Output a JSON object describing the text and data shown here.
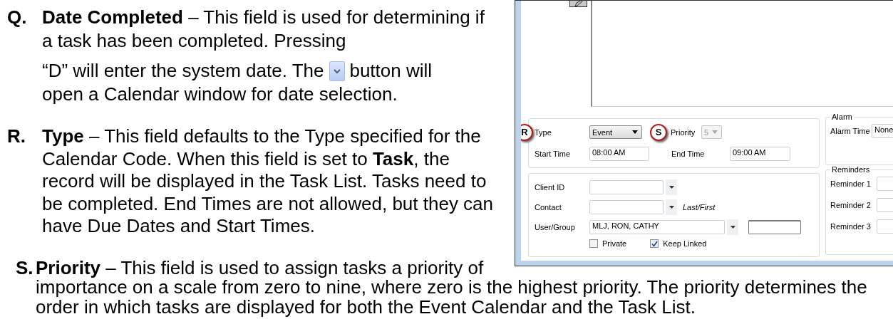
{
  "paragraphs": [
    {
      "letter": "Q.",
      "text": "**Date Completed** – This field is used for determining if a task has been completed. Pressing",
      "text_before_icon": "“D” will enter the system date. The",
      "text_after_icon": "button will",
      "text_end": "open a Calendar window for date selection."
    },
    {
      "letter": "R.",
      "text": "**Type** – This field defaults to the Type specified for the Calendar Code. When this field is set to **Task**, the record will be displayed in the Task List. Tasks need to be completed. End Times are not allowed, but they can have Due Dates and Start Times."
    },
    {
      "letter": "S.",
      "text": "**Priority** – This field is used to assign tasks a priority of importance on a scale from zero to nine, where zero is the highest priority. The priority determines the order in which tasks are displayed for both the Event Calendar and the Task List."
    }
  ],
  "window": {
    "type": {
      "label": "Type",
      "value": "Event",
      "callout": "R"
    },
    "priority": {
      "label": "Priority",
      "value": "5",
      "disabled": true,
      "callout": "S"
    },
    "start_time": {
      "label": "Start Time",
      "value": "08:00 AM"
    },
    "end_time": {
      "label": "End Time",
      "value": "09:00 AM"
    },
    "client_id": {
      "label": "Client ID"
    },
    "contact": {
      "label": "Contact",
      "hint": "Last/First"
    },
    "user_group": {
      "label": "User/Group",
      "value": "MLJ, RON, CATHY"
    },
    "checkboxes": [
      {
        "label": "Private",
        "checked": false
      },
      {
        "label": "Keep Linked",
        "checked": true
      }
    ],
    "alarm": {
      "title": "Alarm",
      "label": "Alarm Time",
      "value": "None"
    },
    "reminders": {
      "title": "Reminders",
      "items": [
        {
          "label": "Reminder 1"
        },
        {
          "label": "Reminder 2"
        },
        {
          "label": "Reminder 3"
        }
      ]
    }
  }
}
